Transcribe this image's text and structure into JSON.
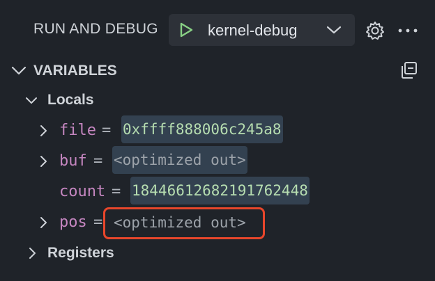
{
  "header": {
    "title": "RUN AND DEBUG",
    "launch_config": "kernel-debug",
    "icons": [
      "play-icon",
      "chevron-down-icon",
      "gear-icon",
      "more-icon"
    ]
  },
  "variables": {
    "title": "VARIABLES",
    "icons": [
      "chevron-down-icon",
      "collapse-all-icon"
    ],
    "groups": [
      {
        "label": "Locals",
        "expanded": true,
        "items": [
          {
            "name": "file",
            "eq": "=",
            "value": "0xffff888006c245a8",
            "expandable": true
          },
          {
            "name": "buf",
            "eq": "=",
            "value": "<optimized out>",
            "expandable": true
          },
          {
            "name": "count",
            "eq": "=",
            "value": "18446612682191762448",
            "expandable": false
          },
          {
            "name": "pos",
            "eq": "=",
            "value": "<optimized out>",
            "expandable": true
          }
        ]
      },
      {
        "label": "Registers",
        "expanded": false
      }
    ]
  },
  "colors": {
    "background": "#1f2329",
    "variable_name": "#c586c0",
    "value_number": "#b6ddb0",
    "value_optimized": "#9da3aa",
    "value_highlight_bg": "#334150",
    "annotation_box": "#e7462b",
    "play_green": "#89d185"
  }
}
